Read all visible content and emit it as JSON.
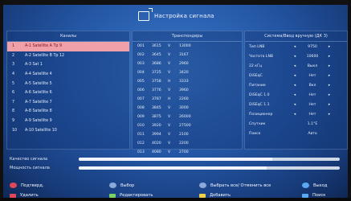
{
  "title": "Настройка сигнала",
  "colors": {
    "selection": "#f0a0a8",
    "red_key": "#e0485a",
    "green_key": "#7bd06a",
    "yellow_key": "#f0cf4a",
    "blue_key": "#5aa8f0"
  },
  "channels_header": "Каналы",
  "channels": [
    {
      "num": "1",
      "name": "A-1 Satellite A Tp 9"
    },
    {
      "num": "2",
      "name": "A-2 Satellite B Tp 12"
    },
    {
      "num": "3",
      "name": "A-3 Sat 1"
    },
    {
      "num": "4",
      "name": "A-4 Satellite 4"
    },
    {
      "num": "5",
      "name": "A-5 Satellite 5"
    },
    {
      "num": "6",
      "name": "A-6 Satellite 6"
    },
    {
      "num": "7",
      "name": "A-7 Satellite 7"
    },
    {
      "num": "8",
      "name": "A-8 Satellite 8"
    },
    {
      "num": "9",
      "name": "A-9 Satellite 9"
    },
    {
      "num": "10",
      "name": "A-10 Satellite 10"
    }
  ],
  "transponders_header": "Транспондеры",
  "transponders": [
    {
      "n": "001",
      "f": "3615",
      "p": "V",
      "s": "13000"
    },
    {
      "n": "002",
      "f": "3645",
      "p": "V",
      "s": "3167"
    },
    {
      "n": "003",
      "f": "3686",
      "p": "V",
      "s": "2960"
    },
    {
      "n": "004",
      "f": "3725",
      "p": "V",
      "s": "3420"
    },
    {
      "n": "005",
      "f": "3758",
      "p": "H",
      "s": "3333"
    },
    {
      "n": "006",
      "f": "3776",
      "p": "V",
      "s": "3960"
    },
    {
      "n": "007",
      "f": "3787",
      "p": "H",
      "s": "2260"
    },
    {
      "n": "008",
      "f": "3845",
      "p": "V",
      "s": "3000"
    },
    {
      "n": "009",
      "f": "3875",
      "p": "V",
      "s": "26000"
    },
    {
      "n": "010",
      "f": "3920",
      "p": "V",
      "s": "27500"
    },
    {
      "n": "011",
      "f": "3994",
      "p": "V",
      "s": "2100"
    },
    {
      "n": "012",
      "f": "4020",
      "p": "V",
      "s": "2200"
    },
    {
      "n": "013",
      "f": "4080",
      "p": "V",
      "s": "2700"
    }
  ],
  "settings_header": "Система/Ввод вручную (ДК 3)",
  "settings": [
    {
      "label": "Тип LNB",
      "value": "9750"
    },
    {
      "label": "Частота LNB",
      "value": "10600"
    },
    {
      "label": "22 кГц",
      "value": "Выкл"
    },
    {
      "label": "DiSEqC",
      "value": "Нет"
    },
    {
      "label": "Питание",
      "value": "Вкл"
    },
    {
      "label": "DiSEqC 1.0",
      "value": "Нет"
    },
    {
      "label": "DiSEqC 1.1",
      "value": "Нет"
    },
    {
      "label": "Позиционер",
      "value": "Нет"
    },
    {
      "label": "Спутник",
      "value": "1.1°E"
    },
    {
      "label": "Поиск",
      "value": "Авто"
    }
  ],
  "progress": [
    {
      "label": "Качество сигнала",
      "percent": 74
    },
    {
      "label": "Мощность сигнала",
      "percent": 72
    }
  ],
  "keys": [
    {
      "label": "Подтверд.",
      "color": "red"
    },
    {
      "label": "Выбор",
      "color": "blue"
    },
    {
      "label": "Выбрать все/ Отменить все",
      "color": "blue"
    },
    {
      "label": "Выход",
      "color": "blue"
    },
    {
      "label": "Удалить",
      "color": "red"
    },
    {
      "label": "Редактировать",
      "color": "green"
    },
    {
      "label": "Добавить",
      "color": "yellow"
    },
    {
      "label": "Поиск",
      "color": "blue"
    }
  ]
}
